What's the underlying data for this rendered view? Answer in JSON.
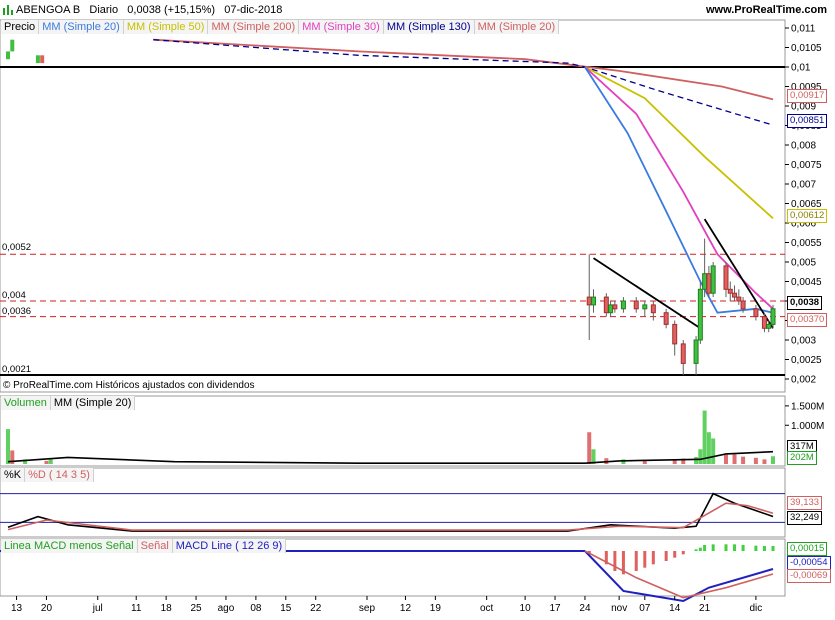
{
  "header": {
    "symbol": "ABENGOA B",
    "period": "Diario",
    "quote": "0,0038 (+15,15%)",
    "date": "07-dic-2018",
    "site": "www.ProRealTime.com"
  },
  "price_panel": {
    "legend": [
      {
        "label": "Precio",
        "color": "#000000"
      },
      {
        "label": "MM (Simple 20)",
        "color": "#3a7be0"
      },
      {
        "label": "MM (Simple 50)",
        "color": "#c8c000"
      },
      {
        "label": "MM (Simple 200)",
        "color": "#d06060"
      },
      {
        "label": "MM (Simple 30)",
        "color": "#e040c0"
      },
      {
        "label": "MM (Simple 130)",
        "color": "#000090"
      },
      {
        "label": "MM (Simple 20)",
        "color": "#d06060"
      }
    ],
    "copyright": "© ProRealTime.com Históricos ajustados con dividendos",
    "y_ticks": [
      "0,011",
      "0,0105",
      "0,01",
      "0,0095",
      "0,009",
      "0,0085",
      "0,008",
      "0,0075",
      "0,007",
      "0,0065",
      "0,006",
      "0,0055",
      "0,005",
      "0,0045",
      "0,004",
      "0,0035",
      "0,003",
      "0,0025",
      "0,002"
    ],
    "levels": [
      "0,0052",
      "0,004",
      "0,0036",
      "0,0021"
    ],
    "badges": [
      {
        "text": "0,00917",
        "color": "#d06060"
      },
      {
        "text": "0,00851",
        "color": "#000090"
      },
      {
        "text": "0,00612",
        "color": "#c8c000"
      },
      {
        "text": "0,0038",
        "color": "#000000"
      },
      {
        "text": "0,00370",
        "color": "#d06060"
      }
    ]
  },
  "volume_panel": {
    "legend": [
      {
        "label": "Volumen",
        "color": "#20a020"
      },
      {
        "label": "MM (Simple 20)",
        "color": "#000000"
      }
    ],
    "y_ticks": [
      "1.500M",
      "1.000M",
      "317M",
      "202M"
    ]
  },
  "stoch_panel": {
    "legend": [
      {
        "label": "%K",
        "color": "#000000"
      },
      {
        "label": "%D ( 14 3 5)",
        "color": "#d06060"
      }
    ],
    "values": [
      "39,133",
      "32,249"
    ]
  },
  "macd_panel": {
    "legend": [
      {
        "label": "Linea MACD menos Señal",
        "color": "#20a020"
      },
      {
        "label": "Señal",
        "color": "#d06060"
      },
      {
        "label": "MACD Line ( 12 26 9)",
        "color": "#2020c0"
      }
    ],
    "values": [
      "0,00015",
      "-0,00054",
      "-0,00069"
    ]
  },
  "x_axis": {
    "ticks": [
      "13",
      "20",
      "jul",
      "11",
      "18",
      "25",
      "ago",
      "08",
      "15",
      "22",
      "sep",
      "12",
      "19",
      "oct",
      "10",
      "17",
      "24",
      "nov",
      "07",
      "14",
      "21",
      "dic"
    ]
  },
  "chart_data": {
    "type": "candlestick",
    "title": "ABENGOA B Diario",
    "x_range": [
      "2018-06-11",
      "2018-12-07"
    ],
    "ylim": [
      0.002,
      0.011
    ],
    "annotations": [
      0.0052,
      0.004,
      0.0036,
      0.0021
    ],
    "last_close": 0.0038,
    "moving_averages": {
      "MM (Simple 200)": 0.00917,
      "MM (Simple 130)": 0.00851,
      "MM (Simple 50)": 0.00612,
      "MM (Simple 20)": 0.0037
    },
    "volume": {
      "ma20": "202M",
      "last": "317M"
    },
    "stochastic": {
      "K": 39.133,
      "D": 32.249
    },
    "macd": {
      "histogram": 0.00015,
      "macd_line": -0.00054,
      "signal": -0.00069
    }
  }
}
